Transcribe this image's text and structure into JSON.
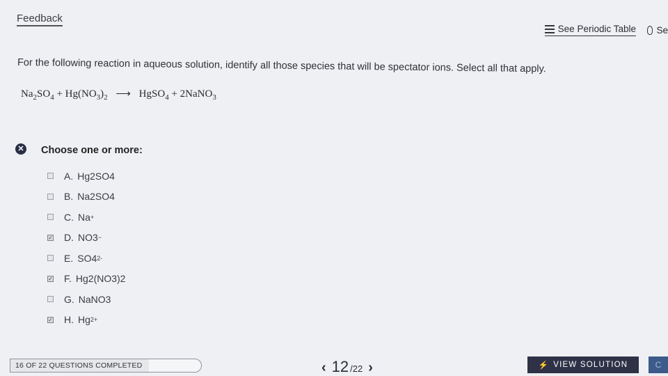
{
  "header": {
    "feedback_tab": "Feedback",
    "periodic_table_link": "See Periodic Table",
    "hint_link": "Se"
  },
  "question": {
    "prompt": "For the following reaction in aqueous solution, identify all those species that will be spectator ions. Select all that apply.",
    "equation": {
      "reactant1": "Na",
      "reactant1_sub1": "2",
      "reactant1_mid": "SO",
      "reactant1_sub2": "4",
      "plus1": "+",
      "reactant2": "Hg(NO",
      "reactant2_sub1": "3",
      "reactant2_close": ")",
      "reactant2_sub2": "2",
      "arrow": "⟶",
      "product1": "HgSO",
      "product1_sub": "4",
      "plus2": "+",
      "product2": "2NaNO",
      "product2_sub": "3"
    }
  },
  "answer_section": {
    "status_icon": "x-icon",
    "choose_label": "Choose one or more:",
    "options": [
      {
        "letter": "A.",
        "text": "Hg2SO4",
        "checked": false
      },
      {
        "letter": "B.",
        "text": "Na2SO4",
        "checked": false
      },
      {
        "letter": "C.",
        "text": "Na",
        "sup": "+",
        "checked": false
      },
      {
        "letter": "D.",
        "text": "NO3",
        "sup": "−",
        "checked": true
      },
      {
        "letter": "E.",
        "text": "SO4",
        "sup": "2-",
        "checked": false
      },
      {
        "letter": "F.",
        "text": "Hg2(NO3)2",
        "checked": true
      },
      {
        "letter": "G.",
        "text": "NaNO3",
        "checked": false
      },
      {
        "letter": "H.",
        "text": "Hg",
        "sup": "2+",
        "checked": true
      }
    ]
  },
  "footer": {
    "progress_text": "16 OF 22 QUESTIONS COMPLETED",
    "progress_fraction": 0.727,
    "pager_prev": "‹",
    "pager_current": "12",
    "pager_total": "/22",
    "pager_next": "›",
    "view_solution_icon": "⚡",
    "view_solution_label": "VIEW SOLUTION",
    "extra_button_label": "C"
  }
}
